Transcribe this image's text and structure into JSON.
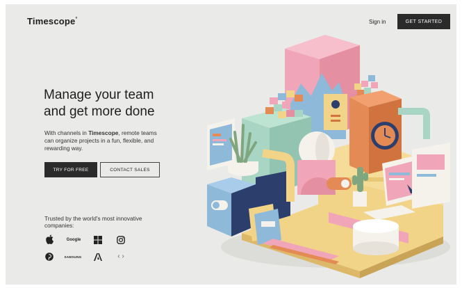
{
  "header": {
    "logo": "Timescope",
    "logo_mark": "°",
    "sign_in": "Sign in",
    "get_started": "GET STARTED"
  },
  "hero": {
    "title_line1": "Manage your team",
    "title_line2": "and get more done",
    "desc_before": "With channels in ",
    "desc_brand": "Timescope",
    "desc_after": ", remote teams can organize projects in a fun, flexible, and rewarding way.",
    "try_button": "TRY FOR FREE",
    "contact_button": "CONTACT SALES"
  },
  "trusted": {
    "text": "Trusted by the world's most innovative companies:",
    "google": "Google",
    "samsung": "SAMSUNG",
    "nav_arrows": "‹ ›"
  },
  "colors": {
    "background": "#eaeae8",
    "button_dark": "#2b2b2b",
    "pink": "#f0a6b8",
    "mint": "#a9d5c4",
    "yellow": "#f2d488",
    "blue": "#8fb9d9",
    "orange": "#e48a55"
  },
  "icons": [
    "apple-icon",
    "windows-icon",
    "instagram-icon",
    "pinterest-icon",
    "adobe-icon"
  ]
}
